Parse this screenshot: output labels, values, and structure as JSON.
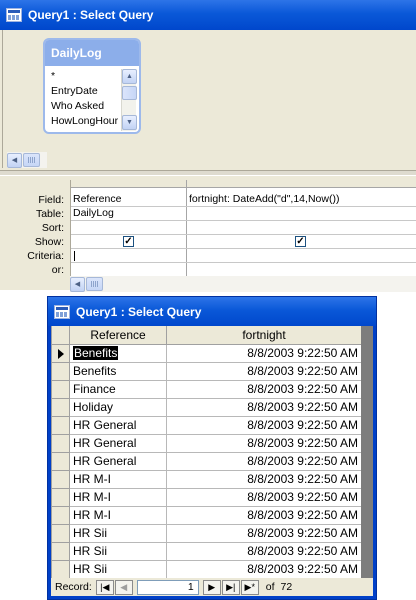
{
  "design_window": {
    "title": "Query1 : Select Query",
    "table_box": {
      "name": "DailyLog",
      "fields": [
        "*",
        "EntryDate",
        "Who Asked",
        "HowLongHour"
      ]
    },
    "grid": {
      "row_labels": [
        "Field:",
        "Table:",
        "Sort:",
        "Show:",
        "Criteria:",
        "or:"
      ],
      "columns": [
        {
          "field": "Reference",
          "table": "DailyLog",
          "sort": "",
          "show": true
        },
        {
          "field": "fortnight: DateAdd(\"d\",14,Now())",
          "table": "",
          "sort": "",
          "show": true
        }
      ]
    }
  },
  "datasheet_window": {
    "title": "Query1 : Select Query",
    "headers": {
      "reference": "Reference",
      "fortnight": "fortnight"
    },
    "rows": [
      {
        "reference": "Benefits",
        "fortnight": "8/8/2003 9:22:50 AM"
      },
      {
        "reference": "Benefits",
        "fortnight": "8/8/2003 9:22:50 AM"
      },
      {
        "reference": "Finance",
        "fortnight": "8/8/2003 9:22:50 AM"
      },
      {
        "reference": "Holiday",
        "fortnight": "8/8/2003 9:22:50 AM"
      },
      {
        "reference": "HR General",
        "fortnight": "8/8/2003 9:22:50 AM"
      },
      {
        "reference": "HR General",
        "fortnight": "8/8/2003 9:22:50 AM"
      },
      {
        "reference": "HR General",
        "fortnight": "8/8/2003 9:22:50 AM"
      },
      {
        "reference": "HR M-I",
        "fortnight": "8/8/2003 9:22:50 AM"
      },
      {
        "reference": "HR M-I",
        "fortnight": "8/8/2003 9:22:50 AM"
      },
      {
        "reference": "HR M-I",
        "fortnight": "8/8/2003 9:22:50 AM"
      },
      {
        "reference": "HR Sii",
        "fortnight": "8/8/2003 9:22:50 AM"
      },
      {
        "reference": "HR Sii",
        "fortnight": "8/8/2003 9:22:50 AM"
      },
      {
        "reference": "HR Sii",
        "fortnight": "8/8/2003 9:22:50 AM"
      }
    ],
    "nav": {
      "record_label": "Record:",
      "current": "1",
      "of_label": "of",
      "total": "72"
    }
  },
  "colors": {
    "title_bar": "#0a58d8",
    "table_box_header": "#8caeea",
    "window_face": "#ece9d8"
  }
}
